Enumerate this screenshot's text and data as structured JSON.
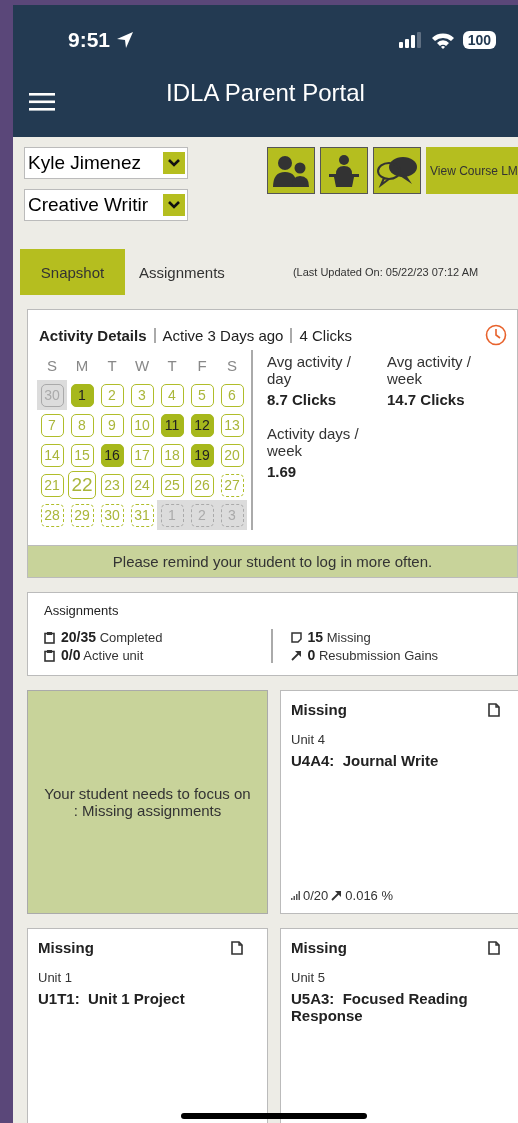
{
  "status_bar": {
    "time": "9:51",
    "battery": "100"
  },
  "header": {
    "title": "IDLA Parent Portal"
  },
  "selectors": [
    {
      "value": "Kyle Jimenez"
    },
    {
      "value": "Creative Writir"
    }
  ],
  "actions": {
    "view_course": "View Course LM"
  },
  "tabs": [
    {
      "label": "Snapshot",
      "selected": true
    },
    {
      "label": "Assignments",
      "selected": false
    }
  ],
  "last_updated": "(Last Updated On: 05/22/23 07:12 AM",
  "activity": {
    "title": "Activity Details",
    "active": "Active 3 Days ago",
    "clicks": "4 Clicks",
    "weekdays": [
      "S",
      "M",
      "T",
      "W",
      "T",
      "F",
      "S"
    ],
    "days": [
      {
        "label": "30",
        "kind": "prev_month"
      },
      {
        "label": "1",
        "kind": "active"
      },
      {
        "label": "2",
        "kind": "normal"
      },
      {
        "label": "3",
        "kind": "normal"
      },
      {
        "label": "4",
        "kind": "normal"
      },
      {
        "label": "5",
        "kind": "normal"
      },
      {
        "label": "6",
        "kind": "normal"
      },
      {
        "label": "7",
        "kind": "normal"
      },
      {
        "label": "8",
        "kind": "normal"
      },
      {
        "label": "9",
        "kind": "normal"
      },
      {
        "label": "10",
        "kind": "normal"
      },
      {
        "label": "11",
        "kind": "active"
      },
      {
        "label": "12",
        "kind": "active"
      },
      {
        "label": "13",
        "kind": "normal"
      },
      {
        "label": "14",
        "kind": "normal"
      },
      {
        "label": "15",
        "kind": "normal"
      },
      {
        "label": "16",
        "kind": "active"
      },
      {
        "label": "17",
        "kind": "normal"
      },
      {
        "label": "18",
        "kind": "normal"
      },
      {
        "label": "19",
        "kind": "active"
      },
      {
        "label": "20",
        "kind": "normal"
      },
      {
        "label": "21",
        "kind": "normal"
      },
      {
        "label": "22",
        "kind": "today"
      },
      {
        "label": "23",
        "kind": "normal"
      },
      {
        "label": "24",
        "kind": "normal"
      },
      {
        "label": "25",
        "kind": "normal"
      },
      {
        "label": "26",
        "kind": "normal"
      },
      {
        "label": "27",
        "kind": "future"
      },
      {
        "label": "28",
        "kind": "future"
      },
      {
        "label": "29",
        "kind": "future"
      },
      {
        "label": "30",
        "kind": "future"
      },
      {
        "label": "31",
        "kind": "future"
      },
      {
        "label": "1",
        "kind": "next_month"
      },
      {
        "label": "2",
        "kind": "next_month"
      },
      {
        "label": "3",
        "kind": "next_month"
      }
    ],
    "stats": [
      {
        "label": "Avg activity / day",
        "value": "8.7 Clicks"
      },
      {
        "label": "Avg activity / week",
        "value": "14.7 Clicks"
      },
      {
        "label": "Activity days / week",
        "value": "1.69"
      }
    ],
    "reminder": "Please remind your student to log in more often."
  },
  "assignments": {
    "title": "Assignments",
    "left": [
      {
        "count": "20/35",
        "label": "Completed"
      },
      {
        "count": "0/0",
        "label": "Active unit"
      }
    ],
    "right": [
      {
        "count": "15",
        "label": "Missing",
        "kind": "missing"
      },
      {
        "count": "0",
        "label": "Resubmission Gains",
        "kind": "gains"
      }
    ]
  },
  "focus": "Your student needs to focus on : Missing assignments",
  "cards": [
    {
      "status": "Missing",
      "unit": "Unit 4",
      "title": "U4A4:  Journal Write",
      "score": "0/20",
      "gain": "0.016 %"
    },
    {
      "status": "Missing",
      "unit": "Unit 1",
      "title": "U1T1:  Unit 1 Project"
    },
    {
      "status": "Missing",
      "unit": "Unit 5",
      "title": "U5A3:  Focused Reading Response"
    }
  ]
}
